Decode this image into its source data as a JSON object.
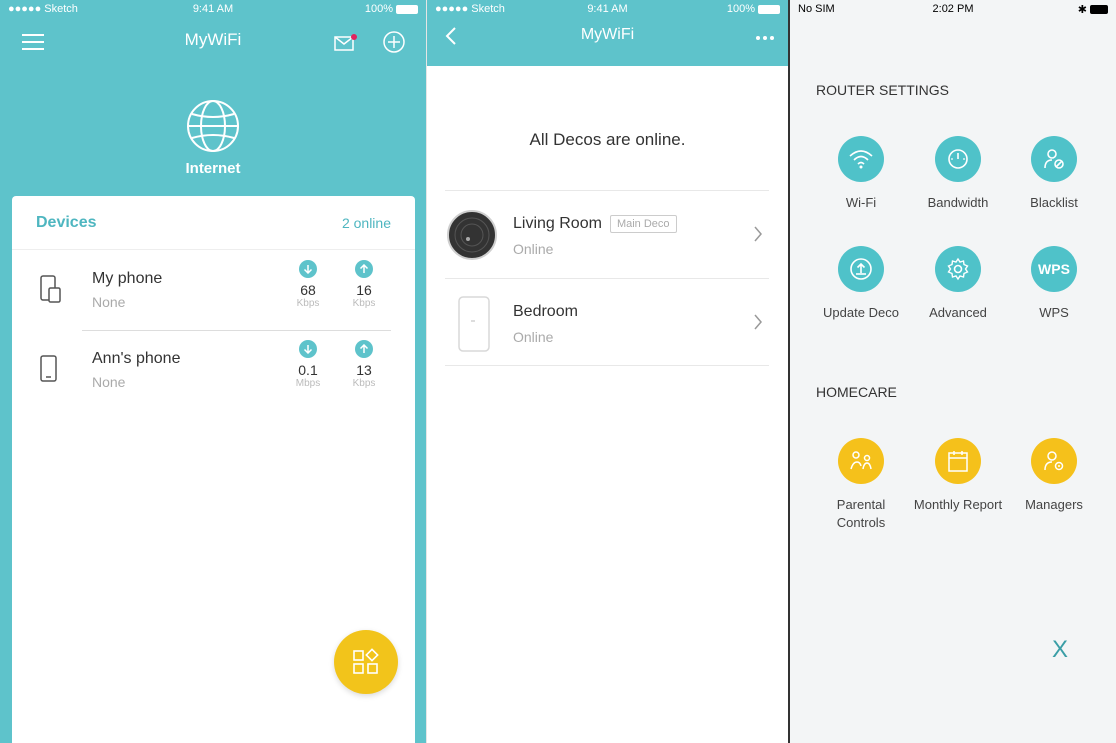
{
  "screen1": {
    "status": {
      "carrier": "●●●●● Sketch",
      "time": "9:41 AM",
      "battery": "100%"
    },
    "nav": {
      "title": "MyWiFi"
    },
    "internet_label": "Internet",
    "devices_title": "Devices",
    "devices_online": "2 online",
    "devices": [
      {
        "name": "My phone",
        "sub": "None",
        "down_value": "68",
        "down_unit": "Kbps",
        "up_value": "16",
        "up_unit": "Kbps"
      },
      {
        "name": "Ann's phone",
        "sub": "None",
        "down_value": "0.1",
        "down_unit": "Mbps",
        "up_value": "13",
        "up_unit": "Kbps"
      }
    ]
  },
  "screen2": {
    "status": {
      "carrier": "●●●●● Sketch",
      "time": "9:41 AM",
      "battery": "100%"
    },
    "nav": {
      "title": "MyWiFi"
    },
    "online_message": "All Decos are online.",
    "decos": [
      {
        "name": "Living Room",
        "tag": "Main Deco",
        "status": "Online"
      },
      {
        "name": "Bedroom",
        "status": "Online"
      }
    ]
  },
  "screen3": {
    "status": {
      "carrier": "No SIM",
      "time": "2:02 PM"
    },
    "router_settings_title": "ROUTER SETTINGS",
    "router_settings": [
      {
        "label": "Wi-Fi",
        "icon": "wifi-icon"
      },
      {
        "label": "Bandwidth",
        "icon": "gauge-icon"
      },
      {
        "label": "Blacklist",
        "icon": "blocked-user-icon"
      },
      {
        "label": "Update Deco",
        "icon": "upload-icon"
      },
      {
        "label": "Advanced",
        "icon": "gear-icon"
      },
      {
        "label": "WPS",
        "icon_text": "WPS"
      }
    ],
    "homecare_title": "HOMECARE",
    "homecare": [
      {
        "label": "Parental Controls",
        "icon": "parental-icon"
      },
      {
        "label": "Monthly Report",
        "icon": "calendar-icon"
      },
      {
        "label": "Managers",
        "icon": "user-gear-icon"
      }
    ],
    "close": "X"
  },
  "colors": {
    "teal": "#5ec3cb",
    "yellow": "#f2c41b"
  }
}
